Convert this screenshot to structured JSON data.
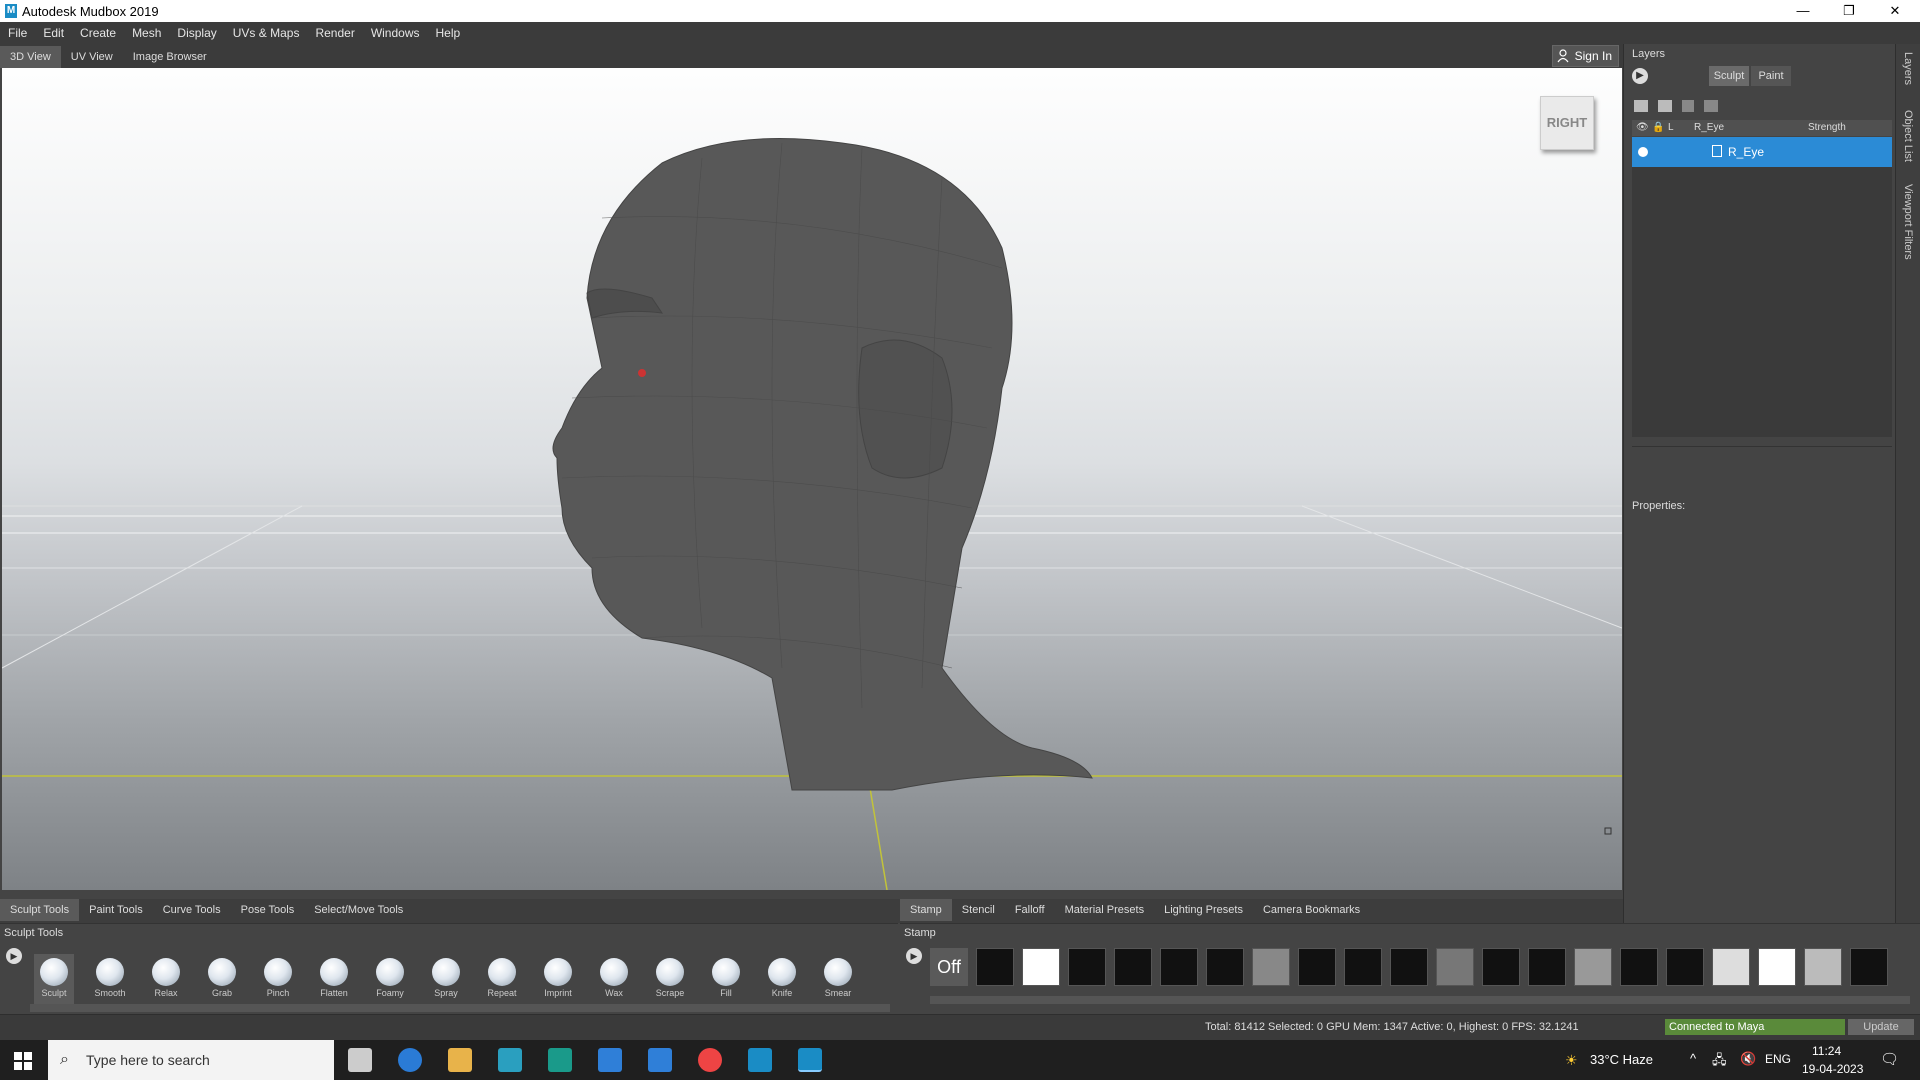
{
  "window": {
    "title": "Autodesk Mudbox 2019",
    "logo_letter": "M",
    "minimize": "—",
    "restore": "❐",
    "close": "✕"
  },
  "menu": [
    "File",
    "Edit",
    "Create",
    "Mesh",
    "Display",
    "UVs & Maps",
    "Render",
    "Windows",
    "Help"
  ],
  "view_tabs": [
    "3D View",
    "UV View",
    "Image Browser"
  ],
  "sign_in": "Sign In",
  "viewcube_label": "RIGHT",
  "layers": {
    "title": "Layers",
    "mode_sculpt": "Sculpt",
    "mode_paint": "Paint",
    "col_l": "L",
    "col_name": "R_Eye",
    "col_strength": "Strength",
    "row_name": "R_Eye",
    "properties": "Properties:"
  },
  "side_strip": [
    "Layers",
    "Object List",
    "Viewport Filters"
  ],
  "bottom_tabs_left": [
    "Sculpt Tools",
    "Paint Tools",
    "Curve Tools",
    "Pose Tools",
    "Select/Move Tools"
  ],
  "bottom_tabs_right": [
    "Stamp",
    "Stencil",
    "Falloff",
    "Material Presets",
    "Lighting Presets",
    "Camera Bookmarks"
  ],
  "sculpt_panel_title": "Sculpt Tools",
  "stamp_panel_title": "Stamp",
  "sculpt_tools": [
    "Sculpt",
    "Smooth",
    "Relax",
    "Grab",
    "Pinch",
    "Flatten",
    "Foamy",
    "Spray",
    "Repeat",
    "Imprint",
    "Wax",
    "Scrape",
    "Fill",
    "Knife",
    "Smear"
  ],
  "stamp_off": "Off",
  "status": {
    "text": "Total: 81412  Selected: 0 GPU Mem: 1347  Active: 0, Highest: 0  FPS: 32.1241",
    "connected": "Connected to Maya",
    "update": "Update"
  },
  "taskbar": {
    "search_placeholder": "Type here to search",
    "weather": "33°C  Haze",
    "lang": "ENG",
    "time": "11:24",
    "date": "19-04-2023"
  }
}
